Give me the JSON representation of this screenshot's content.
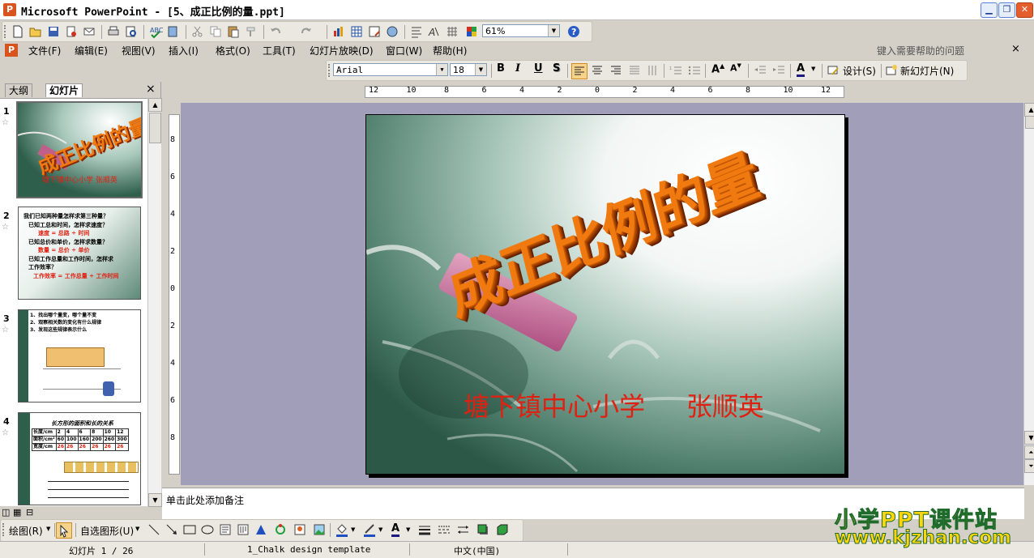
{
  "window": {
    "title": "Microsoft PowerPoint - [5、成正比例的量.ppt]",
    "app_icon": "P"
  },
  "standard_toolbar": {
    "zoom": "61%"
  },
  "menubar": {
    "items": [
      "文件(F)",
      "编辑(E)",
      "视图(V)",
      "插入(I)",
      "格式(O)",
      "工具(T)",
      "幻灯片放映(D)",
      "窗口(W)",
      "帮助(H)"
    ],
    "help_placeholder": "键入需要帮助的问题",
    "close_glyph": "×"
  },
  "format_toolbar": {
    "font": "Arial",
    "size": "18",
    "bold": "B",
    "italic": "I",
    "underline": "U",
    "shadow": "S",
    "design_label": "设计(S)",
    "new_slide_label": "新幻灯片(N)"
  },
  "left_panel": {
    "tabs": [
      "大纲",
      "幻灯片"
    ],
    "close_glyph": "×",
    "slides": [
      {
        "number": "1",
        "title": "成正比例的量",
        "subtitle": "塘下镇中心小学   张顺英"
      },
      {
        "number": "2",
        "lines": [
          "我们已知两种量怎样求第三种量？",
          "已知工总和时间，怎样求速度？",
          "速度 = 总路 ÷ 时间",
          "已知总价和单价，怎样求数量？",
          "数量 = 总价 ÷ 单价",
          "已知工作总量和工作时间，怎样求",
          "工作效率？",
          "工作效率 = 工作总量 ÷ 工作时间"
        ]
      },
      {
        "number": "3",
        "lines": [
          "1、找出哪个量变，哪个量不变",
          "2、观察相关数的变化有什么规律",
          "3、发现这些规律表示什么"
        ]
      },
      {
        "number": "4",
        "title": "长方形的面积和长的关系",
        "header": [
          "长度/cm",
          "2",
          "4",
          "6",
          "8",
          "10",
          "12"
        ],
        "row1": [
          "面积/cm²",
          "60",
          "100",
          "160",
          "200",
          "260",
          "300"
        ],
        "row2": [
          "宽度/cm",
          "26",
          "26",
          "26",
          "26",
          "26",
          "26"
        ]
      }
    ]
  },
  "slide": {
    "title": "成正比例的量",
    "subtitle": "塘下镇中心小学     张顺英"
  },
  "ruler": {
    "h_labels": [
      "12",
      "10",
      "8",
      "6",
      "4",
      "2",
      "0",
      "2",
      "4",
      "6",
      "8",
      "10",
      "12"
    ],
    "v_labels": [
      "8",
      "6",
      "4",
      "2",
      "0",
      "2",
      "4",
      "6",
      "8"
    ]
  },
  "notes": {
    "placeholder": "单击此处添加备注"
  },
  "draw_toolbar": {
    "draw_label": "绘图(R)",
    "autoshapes_label": "自选图形(U)"
  },
  "statusbar": {
    "slide_info": "幻灯片 1 / 26",
    "template": "1_Chalk design template",
    "language": "中文(中国)"
  },
  "watermark": {
    "line1": "小学PPT课件站",
    "line2": "www.kjzhan.com"
  },
  "colors": {
    "title_orange": "#F07A10",
    "subtitle_red": "#E02010",
    "workspace": "#A19EB9"
  }
}
